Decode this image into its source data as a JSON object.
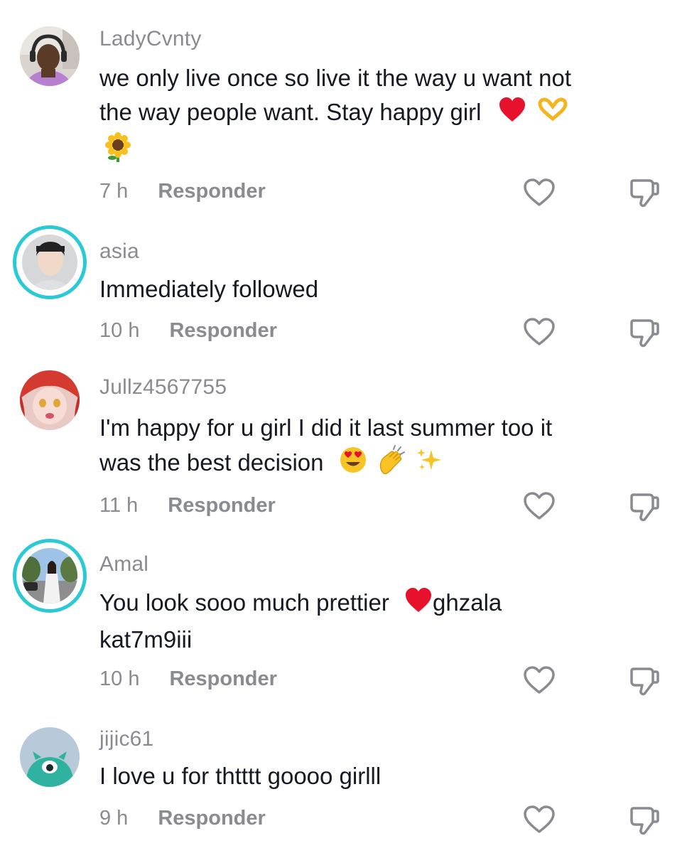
{
  "comments": [
    {
      "username": "LadyCvnty",
      "text_line1": "we only live once so live it the way u want not",
      "text_line2": "the way people want. Stay happy girl",
      "time": "7 h",
      "reply_label": "Responder",
      "story_ring": false
    },
    {
      "username": "asia",
      "text_line1": "Immediately followed",
      "time": "10 h",
      "reply_label": "Responder",
      "story_ring": true
    },
    {
      "username": "Jullz4567755",
      "text_line1": "I'm happy for u girl I did it last summer too it",
      "text_line2": "was the best decision",
      "time": "11 h",
      "reply_label": "Responder",
      "story_ring": false
    },
    {
      "username": "Amal",
      "text_line1": "You look sooo much prettier",
      "text_line1_after": "ghzala",
      "text_line2": "kat7m9iii",
      "time": "10 h",
      "reply_label": "Responder",
      "story_ring": true
    },
    {
      "username": "jijic61",
      "text_line1": "I love u for thtttt goooo girlll",
      "time": "9 h",
      "reply_label": "Responder",
      "story_ring": false
    }
  ],
  "icons": {
    "like": "heart-outline-icon",
    "dislike": "thumbs-down-icon"
  },
  "colors": {
    "text": "#161823",
    "secondary": "#8a8b91",
    "story_ring": "#29c9d6",
    "heart_emoji": "#e8112d"
  }
}
